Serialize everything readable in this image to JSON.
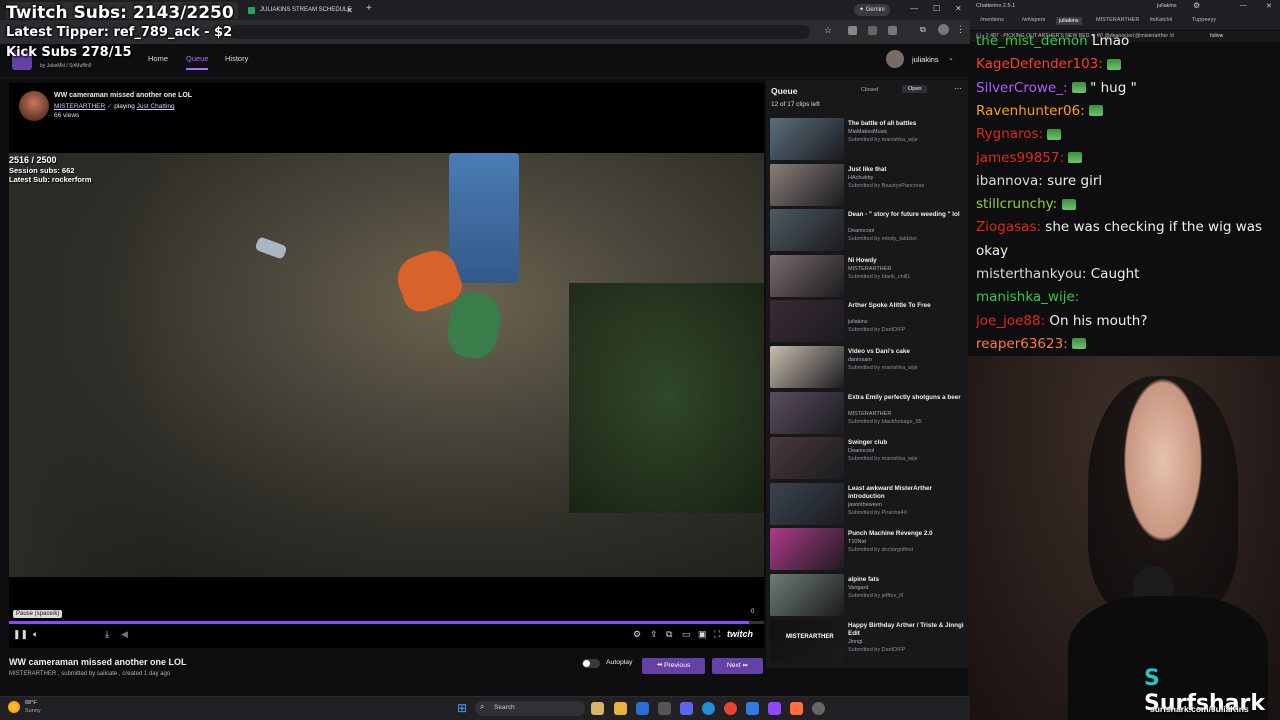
{
  "browser": {
    "tabs": [
      {
        "label": "",
        "active": true
      },
      {
        "label": "JULIAKINS STREAM SCHEDULE",
        "active": false
      }
    ],
    "new_tab": "+",
    "profile_label": "Gemini"
  },
  "overlay": {
    "twitch_subs": "Twitch Subs: 2143/2250",
    "latest_tipper": "Latest Tipper: ref_789_ack - $2",
    "kick_subs": "Kick Subs 278/15"
  },
  "site": {
    "credits": "by  JakeMkl / SirMuffin9",
    "nav": {
      "home": "Home",
      "queue": "Queue",
      "history": "History"
    },
    "username": "juliakins"
  },
  "player": {
    "clip_title": "WW cameraman missed another one LOL",
    "broadcaster": "MISTERARTHER",
    "playing_label": "playing",
    "game": "Just Chatting",
    "views": "66 views",
    "goal": "2516 / 2500",
    "session_subs": "Session subs: 662",
    "latest_sub": "Latest Sub: rockerform",
    "tooltip": "Pause (space/k)",
    "time_right": "0",
    "brand": "twitch",
    "progress": 0.98
  },
  "below": {
    "title": "WW cameraman missed another one LOL",
    "meta": "MISTERARTHER , submitted by salicate , created 1 day ago",
    "autoplay": "Autoplay",
    "previous": "Previous",
    "next": "Next"
  },
  "queue": {
    "heading": "Queue",
    "closed": "Closed",
    "open": "Open",
    "count": "12 of 17 clips left",
    "items": [
      {
        "title": "The battle of all battles",
        "channel": "MiaMakesMusic",
        "submitted": "Submitted by manishka_wije",
        "color": "#5a6f7d"
      },
      {
        "title": "Just like that",
        "channel": "HAchubby",
        "submitted": "Submitted by BeastyxPancreas",
        "color": "#8a7d78"
      },
      {
        "title": "Dean - \" story for future weeding \" lol",
        "channel": "Deanocool",
        "submitted": "Submitted by mlody_faldzior",
        "color": "#4e5a62"
      },
      {
        "title": "Ni Howdy",
        "channel": "MISTERARTHER",
        "submitted": "Submitted by blank_chill1",
        "color": "#7a6a6e"
      },
      {
        "title": "Arther Spoke Alittle To Free",
        "channel": "juliakins",
        "submitted": "Submitted by DaniDIFP",
        "color": "#3c2a35"
      },
      {
        "title": "Video vs Dani's cake",
        "channel": "daniosam",
        "submitted": "Submitted by manishka_wije",
        "color": "#c9bfae"
      },
      {
        "title": "Extra Emily perfectly shotguns a beer",
        "channel": "MISTERARTHER",
        "submitted": "Submitted by blackhokage_95",
        "color": "#5b4d5e"
      },
      {
        "title": "Swinger club",
        "channel": "Deanocool",
        "submitted": "Submitted by manishka_wije",
        "color": "#4a3a3e"
      },
      {
        "title": "Least awkward MisterArther introduction",
        "channel": "jasontheween",
        "submitted": "Submitted by Piranha4X",
        "color": "#3a4552"
      },
      {
        "title": "Punch Machine Revenge 2.0",
        "channel": "T10Nat",
        "submitted": "Submitted by doctorgolfest",
        "color": "#b03a8c"
      },
      {
        "title": "alpine fats",
        "channel": "Vangard",
        "submitted": "Submitted by jefftex_ill",
        "color": "#6d7d74"
      },
      {
        "title": "Happy Birthday Arther / Triste & Jinngi Edit",
        "channel": "Jinngi",
        "submitted": "Submitted by DaniDIFP",
        "color": "#111111",
        "thumb_text": "MISTERARTHER"
      }
    ]
  },
  "chat": {
    "app_title": "Chatterino 2.5.1",
    "user": "juliakins",
    "tabs": [
      "/mentions",
      "/whispers",
      "juliakins",
      "MISTERARTHER",
      "itsKatchii",
      "Tuppeeyy"
    ],
    "active_tab": "juliakins",
    "status_line": "(-) - 2,487 - PICKING OUT ARTHER'S NEW BED ❤ W/ @deanocool @misterarther !d",
    "follow": "follow",
    "messages": [
      {
        "user": "the_mist_demon",
        "text": "Lmao",
        "color": "#2ecc40"
      },
      {
        "user": "KageDefender103:",
        "text": "",
        "color": "#ff3b30",
        "emote": true
      },
      {
        "user": "SilverCrowe_:",
        "text": "\" hug \"",
        "color": "#b55cff",
        "emote": true
      },
      {
        "user": "Ravenhunter06:",
        "text": "",
        "color": "#ff9f0a",
        "emote": true
      },
      {
        "user": "Rygnaros:",
        "text": "",
        "color": "#e0281b",
        "emote": true
      },
      {
        "user": "james99857:",
        "text": "",
        "color": "#e0281b",
        "emote": true
      },
      {
        "user": "ibannova:",
        "text": "sure girl",
        "color": "#d8d8d8"
      },
      {
        "user": "stillcrunchy:",
        "text": "",
        "color": "#9acd32",
        "emote": true
      },
      {
        "user": "Ziogasas:",
        "text": "she was checking if the wig was",
        "color": "#e0281b"
      },
      {
        "user": "",
        "text": "okay",
        "color": "#d8d8d8"
      },
      {
        "user": "misterthankyou:",
        "text": "Caught",
        "color": "#d8d8d8"
      },
      {
        "user": "manishka_wije:",
        "text": "",
        "color": "#2ecc40"
      },
      {
        "user": "joe_joe88:",
        "text": "On his mouth?",
        "color": "#e0281b"
      },
      {
        "user": "reaper63623:",
        "text": "",
        "color": "#ff7a3c",
        "emote": true
      }
    ]
  },
  "webcam": {
    "sponsor": "Surfshark",
    "sponsor_url": "surfshark.com/JuliaKins"
  },
  "taskbar": {
    "weather_temp": "68°F",
    "weather_desc": "Sunny",
    "search": "Search"
  }
}
